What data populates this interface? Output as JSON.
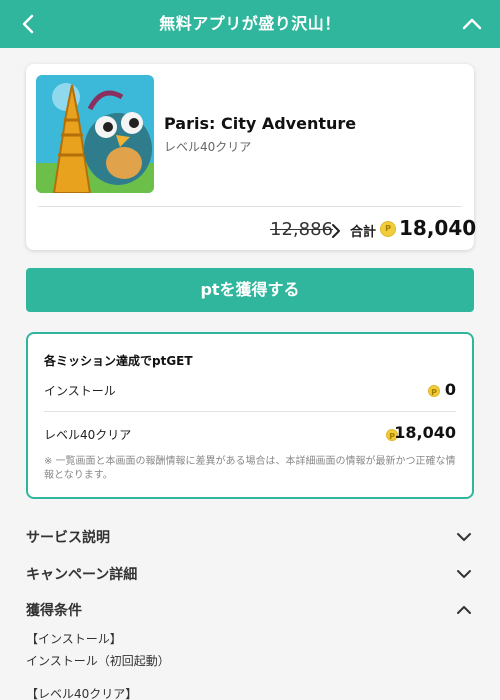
{
  "header": {
    "title": "無料アプリが盛り沢山！",
    "back_icon": "chevron-left-icon",
    "collapse_icon": "chevron-up-icon",
    "color": "#2fb69c"
  },
  "app_card": {
    "name": "Paris: City Adventure",
    "subtitle": "レベル40クリア",
    "old_points": "12,886",
    "total_label": "合計",
    "total_points": "18,040"
  },
  "get_button": {
    "label": "ptを獲得する"
  },
  "mission": {
    "title": "各ミッション達成でptGET",
    "rows": [
      {
        "label": "インストール",
        "points": "0"
      },
      {
        "label": "レベル40クリア",
        "points": "18,040"
      }
    ],
    "note": "※ 一覧画面と本画面の報酬情報に差異がある場合は、本詳細画面の情報が最新かつ正確な情報となります。"
  },
  "sections": [
    {
      "label": "サービス説明",
      "state": "collapsed"
    },
    {
      "label": "キャンペーン詳細",
      "state": "collapsed"
    },
    {
      "label": "獲得条件",
      "state": "expanded"
    }
  ],
  "conditions": [
    "【インストール】",
    "インストール（初回起動）",
    "【レベル40クリア】"
  ]
}
